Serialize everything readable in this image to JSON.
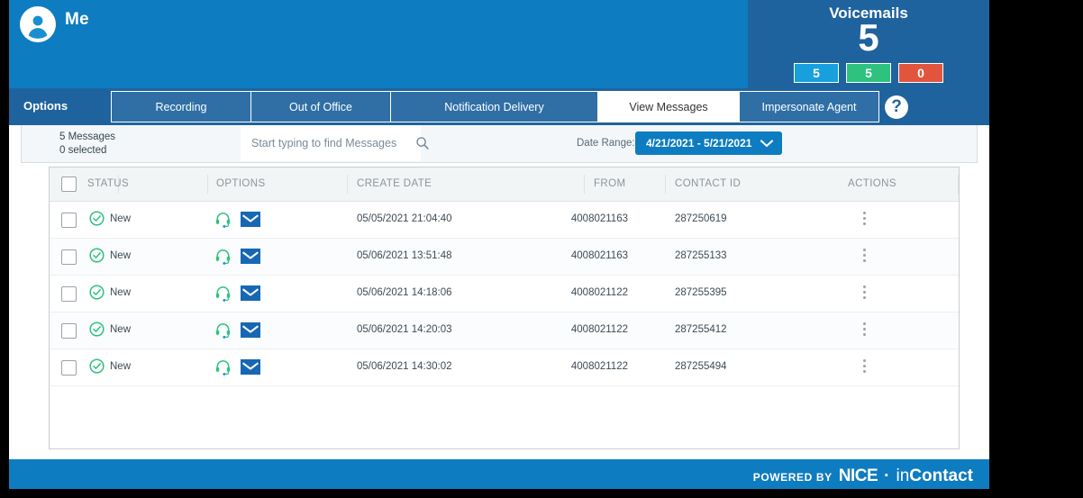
{
  "header": {
    "user_label": "Me",
    "avatar_icon": "user-avatar-icon",
    "voicemails": {
      "title": "Voicemails",
      "total": "5",
      "chips": [
        {
          "value": "5",
          "color": "#17a0dd"
        },
        {
          "value": "5",
          "color": "#2ec27e"
        },
        {
          "value": "0",
          "color": "#e2553d"
        }
      ]
    }
  },
  "nav": {
    "options_label": "Options",
    "help_label": "?",
    "tabs": [
      {
        "label": "Recording",
        "active": false
      },
      {
        "label": "Out of Office",
        "active": false
      },
      {
        "label": "Notification Delivery",
        "active": false
      },
      {
        "label": "View Messages",
        "active": true
      },
      {
        "label": "Impersonate Agent",
        "active": false
      }
    ]
  },
  "toolbar": {
    "message_count": "5 Messages",
    "selected_count": "0 selected",
    "search_placeholder": "Start typing to find Messages",
    "search_value": "",
    "search_icon": "search-icon",
    "date_range_label": "Date Range:",
    "date_range_value": "4/21/2021 - 5/21/2021",
    "date_range_chevron": "chevron-down-icon"
  },
  "table": {
    "columns": [
      "STATUS",
      "OPTIONS",
      "CREATE DATE",
      "FROM",
      "CONTACT ID",
      "ACTIONS"
    ],
    "rows": [
      {
        "status": "New",
        "status_icon": "check-circle-icon",
        "options_icons": [
          "headset-icon",
          "envelope-icon"
        ],
        "create_date": "05/05/2021 21:04:40",
        "from": "4008021163",
        "contact_id": "287250619",
        "actions_icon": "kebab-menu-icon"
      },
      {
        "status": "New",
        "status_icon": "check-circle-icon",
        "options_icons": [
          "headset-icon",
          "envelope-icon"
        ],
        "create_date": "05/06/2021 13:51:48",
        "from": "4008021163",
        "contact_id": "287255133",
        "actions_icon": "kebab-menu-icon"
      },
      {
        "status": "New",
        "status_icon": "check-circle-icon",
        "options_icons": [
          "headset-icon",
          "envelope-icon"
        ],
        "create_date": "05/06/2021 14:18:06",
        "from": "4008021122",
        "contact_id": "287255395",
        "actions_icon": "kebab-menu-icon"
      },
      {
        "status": "New",
        "status_icon": "check-circle-icon",
        "options_icons": [
          "headset-icon",
          "envelope-icon"
        ],
        "create_date": "05/06/2021 14:20:03",
        "from": "4008021122",
        "contact_id": "287255412",
        "actions_icon": "kebab-menu-icon"
      },
      {
        "status": "New",
        "status_icon": "check-circle-icon",
        "options_icons": [
          "headset-icon",
          "envelope-icon"
        ],
        "create_date": "05/06/2021 14:30:02",
        "from": "4008021122",
        "contact_id": "287255494",
        "actions_icon": "kebab-menu-icon"
      }
    ]
  },
  "footer": {
    "powered_by": "POWERED BY",
    "brand_primary": "NICE",
    "brand_separator": "·",
    "brand_secondary_light": "in",
    "brand_secondary_bold": "Contact"
  },
  "colors": {
    "banner_blue": "#0e7cc0",
    "nav_blue": "#1f639e",
    "accent_green": "#2ec27e",
    "accent_red": "#e2553d",
    "accent_cyan": "#17a0dd"
  }
}
